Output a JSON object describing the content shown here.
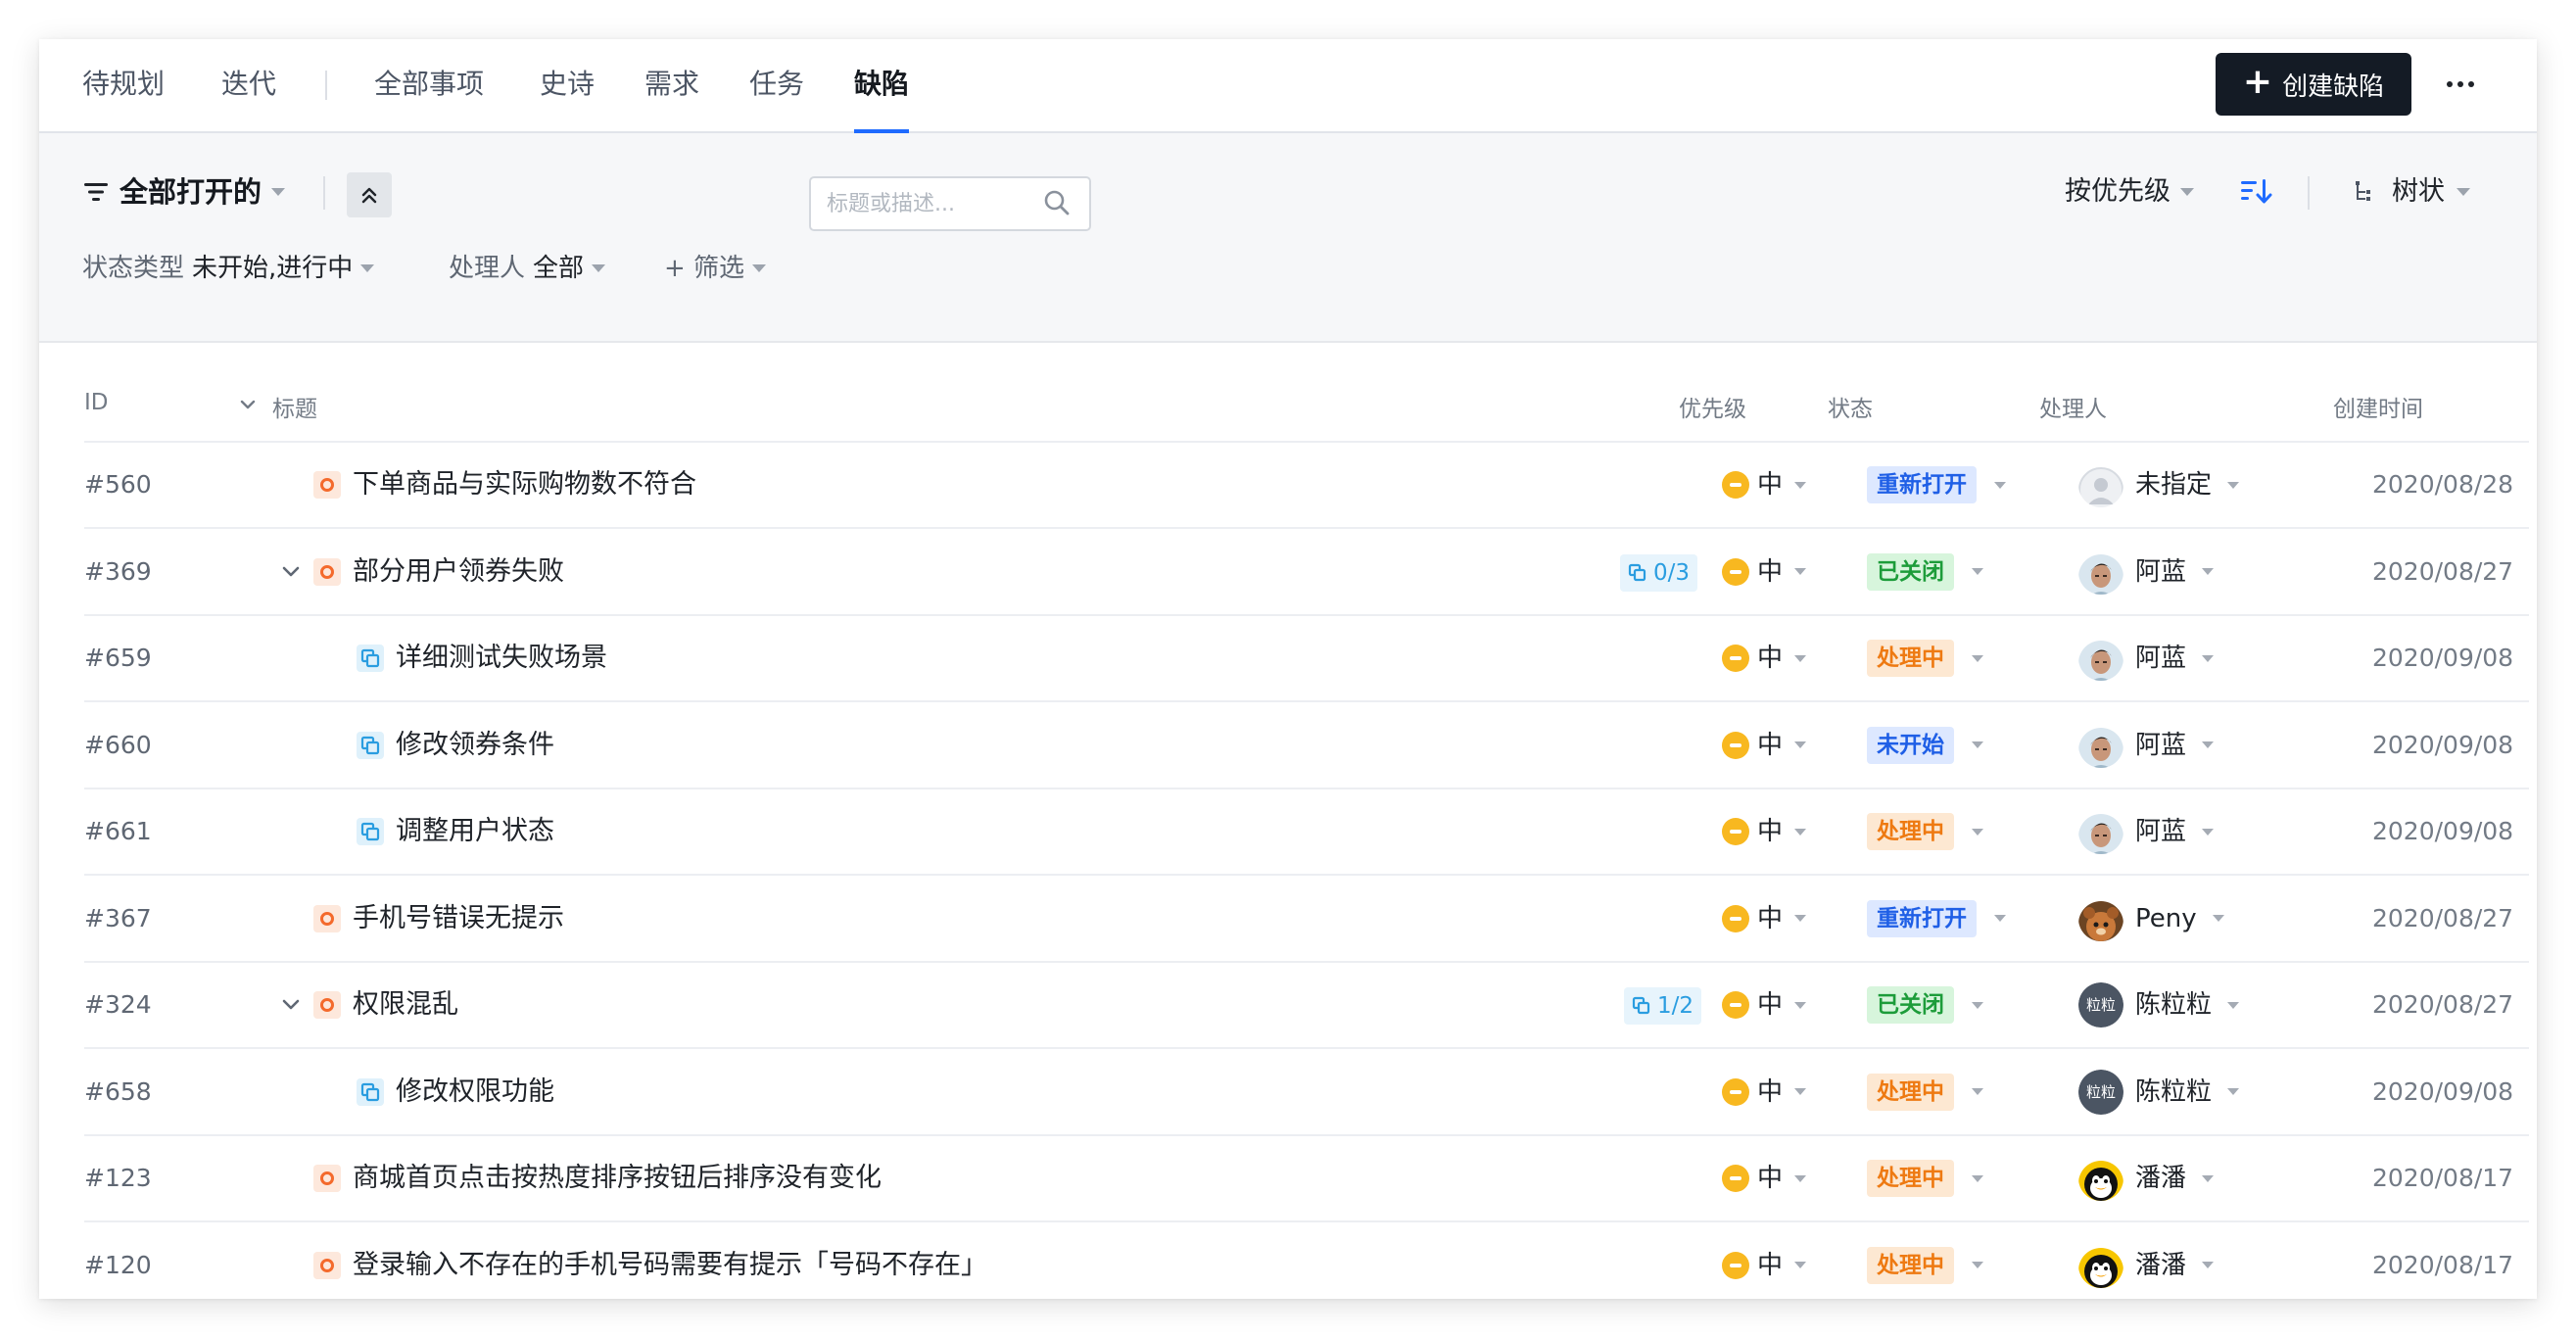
{
  "nav": {
    "tabs": [
      {
        "label": "待规划"
      },
      {
        "label": "迭代"
      },
      {
        "label": "全部事项"
      },
      {
        "label": "史诗"
      },
      {
        "label": "需求"
      },
      {
        "label": "任务"
      },
      {
        "label": "缺陷"
      }
    ],
    "active_tab": "缺陷",
    "create_label": "创建缺陷"
  },
  "filters": {
    "view_label": "全部打开的",
    "sort_label": "按优先级",
    "tree_label": "树状",
    "status_type_label": "状态类型",
    "status_type_value": "未开始,进行中",
    "assignee_label": "处理人",
    "assignee_value": "全部",
    "add_filter_label": "+ 筛选",
    "search_placeholder": "标题或描述..."
  },
  "table": {
    "columns": {
      "id": "ID",
      "title": "标题",
      "priority": "优先级",
      "status": "状态",
      "assignee": "处理人",
      "created": "创建时间"
    },
    "rows": [
      {
        "id": "#560",
        "title": "下单商品与实际购物数不符合",
        "priority": "中",
        "status": "重新打开",
        "assignee": "未指定",
        "created": "2020/08/28"
      },
      {
        "id": "#369",
        "title": "部分用户领券失败",
        "subcount": "0/3",
        "priority": "中",
        "status": "已关闭",
        "assignee": "阿蓝",
        "created": "2020/08/27"
      },
      {
        "id": "#659",
        "title": "详细测试失败场景",
        "priority": "中",
        "status": "处理中",
        "assignee": "阿蓝",
        "created": "2020/09/08"
      },
      {
        "id": "#660",
        "title": "修改领券条件",
        "priority": "中",
        "status": "未开始",
        "assignee": "阿蓝",
        "created": "2020/09/08"
      },
      {
        "id": "#661",
        "title": "调整用户状态",
        "priority": "中",
        "status": "处理中",
        "assignee": "阿蓝",
        "created": "2020/09/08"
      },
      {
        "id": "#367",
        "title": "手机号错误无提示",
        "priority": "中",
        "status": "重新打开",
        "assignee": "Peny",
        "created": "2020/08/27"
      },
      {
        "id": "#324",
        "title": "权限混乱",
        "subcount": "1/2",
        "priority": "中",
        "status": "已关闭",
        "assignee": "陈粒粒",
        "created": "2020/08/27"
      },
      {
        "id": "#658",
        "title": "修改权限功能",
        "priority": "中",
        "status": "处理中",
        "assignee": "陈粒粒",
        "created": "2020/09/08"
      },
      {
        "id": "#123",
        "title": "商城首页点击按热度排序按钮后排序没有变化",
        "priority": "中",
        "status": "处理中",
        "assignee": "潘潘",
        "created": "2020/08/17"
      },
      {
        "id": "#120",
        "title": "登录输入不存在的手机号码需要有提示「号码不存在」",
        "priority": "中",
        "status": "处理中",
        "assignee": "潘潘",
        "created": "2020/08/17"
      }
    ],
    "avatar_initials": "粒粒"
  },
  "colors": {
    "accent": "#1f6bff",
    "create_button": "#141b25",
    "priority_medium": "#f8b820",
    "status_reopen_bg": "#dde8ff",
    "status_reopen_fg": "#1f5fe6",
    "status_closed_bg": "#d7f5dc",
    "status_closed_fg": "#1d9c3a",
    "status_processing_bg": "#fde8d2",
    "status_processing_fg": "#ee7a12",
    "status_notstarted_bg": "#dde8ff",
    "status_notstarted_fg": "#1f5fe6"
  },
  "icons": {
    "bug_type": "bug-circle-icon",
    "subtask_type": "subtask-icon",
    "priority": "priority-medium-icon",
    "search": "search-icon",
    "sort": "sort-desc-icon",
    "tree": "tree-icon",
    "collapse": "chevron-double-up-icon"
  }
}
